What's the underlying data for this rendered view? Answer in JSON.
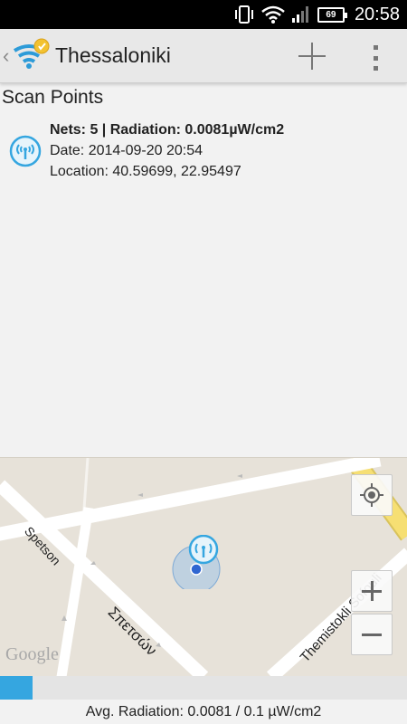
{
  "status_bar": {
    "time": "20:58",
    "battery_level": "69",
    "icons": [
      "vibrate-icon",
      "wifi-icon",
      "signal-icon",
      "battery-icon"
    ]
  },
  "action_bar": {
    "title": "Thessaloniki",
    "icons": [
      "back-caret-icon",
      "app-logo-icon",
      "add-icon",
      "overflow-menu-icon"
    ]
  },
  "list": {
    "section_title": "Scan Points",
    "items": [
      {
        "icon": "antenna-icon",
        "summary": "Nets: 5 | Radiation: 0.0081µW/cm2",
        "date": "Date: 2014-09-20 20:54",
        "location": "Location: 40.59699, 22.95497"
      }
    ]
  },
  "map": {
    "street_labels": [
      "Spetson",
      "Σπετσών",
      "Themistokli Sofouli"
    ],
    "attribution": "Google",
    "controls": [
      "locate-icon",
      "zoom-in-icon",
      "zoom-out-icon"
    ]
  },
  "footer": {
    "progress_fraction": 0.081,
    "avg_radiation_text": "Avg. Radiation: 0.0081 / 0.1 µW/cm2"
  },
  "colors": {
    "accent": "#35a6e0",
    "map_bg": "#e7e2d9",
    "road": "#ffffff",
    "highway": "#f6df73"
  }
}
